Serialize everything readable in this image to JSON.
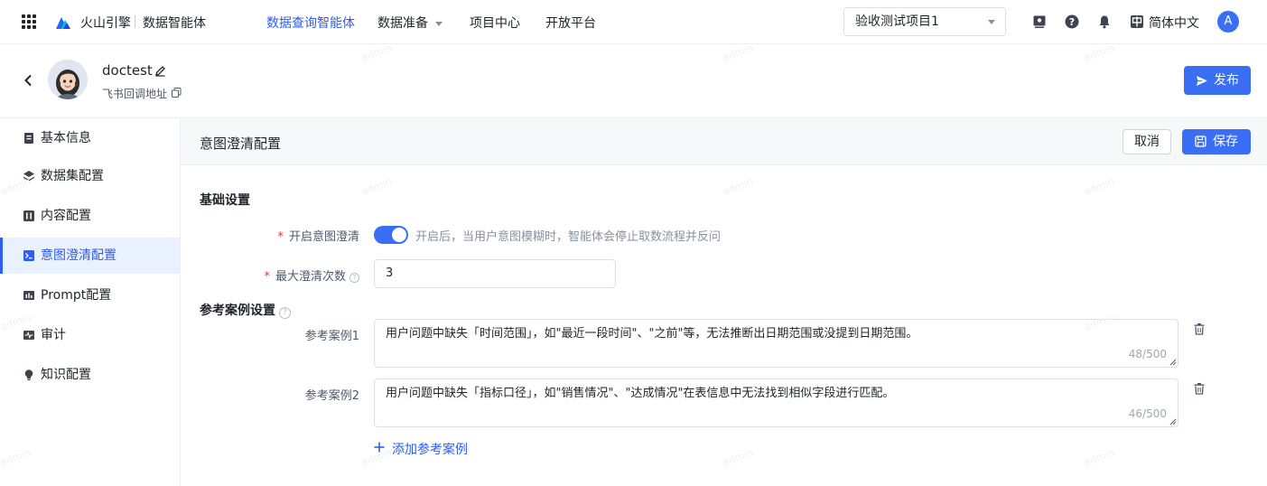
{
  "topnav": {
    "brand": "火山引擎",
    "product": "数据智能体",
    "menu": [
      {
        "label": "数据查询智能体"
      },
      {
        "label": "数据准备"
      },
      {
        "label": "项目中心"
      },
      {
        "label": "开放平台"
      }
    ],
    "project": "验收测试项目1",
    "language": "简体中文",
    "user_initial": "A"
  },
  "header": {
    "bot_name": "doctest",
    "callback_label": "飞书回调地址",
    "publish_label": "发布"
  },
  "sidebar": {
    "items": [
      {
        "label": "基本信息",
        "icon": "doc-icon"
      },
      {
        "label": "数据集配置",
        "icon": "layers-icon"
      },
      {
        "label": "内容配置",
        "icon": "content-icon"
      },
      {
        "label": "意图澄清配置",
        "icon": "terminal-icon",
        "active": true
      },
      {
        "label": "Prompt配置",
        "icon": "chart-icon"
      },
      {
        "label": "审计",
        "icon": "pulse-icon"
      },
      {
        "label": "知识配置",
        "icon": "bulb-icon"
      }
    ]
  },
  "section": {
    "title": "意图澄清配置",
    "cancel_label": "取消",
    "save_label": "保存",
    "basic_title": "基础设置",
    "enable_label": "开启意图澄清",
    "enable_on": true,
    "enable_hint": "开启后，当用户意图模糊时，智能体会停止取数流程并反问",
    "max_label": "最大澄清次数",
    "max_value": "3",
    "cases_title": "参考案例设置",
    "cases": [
      {
        "label": "参考案例1",
        "text": "用户问题中缺失「时间范围」，如\"最近一段时间\"、\"之前\"等，无法推断出日期范围或没提到日期范围。",
        "counter": "48/500"
      },
      {
        "label": "参考案例2",
        "text": "用户问题中缺失「指标口径」，如\"销售情况\"、\"达成情况\"在表信息中无法找到相似字段进行匹配。",
        "counter": "46/500"
      }
    ],
    "add_case_label": "添加参考案例"
  },
  "watermark": "admin",
  "colors": {
    "accent": "#3a6ff5",
    "active_bg": "#eaf1fe",
    "required": "#e83a3a"
  }
}
